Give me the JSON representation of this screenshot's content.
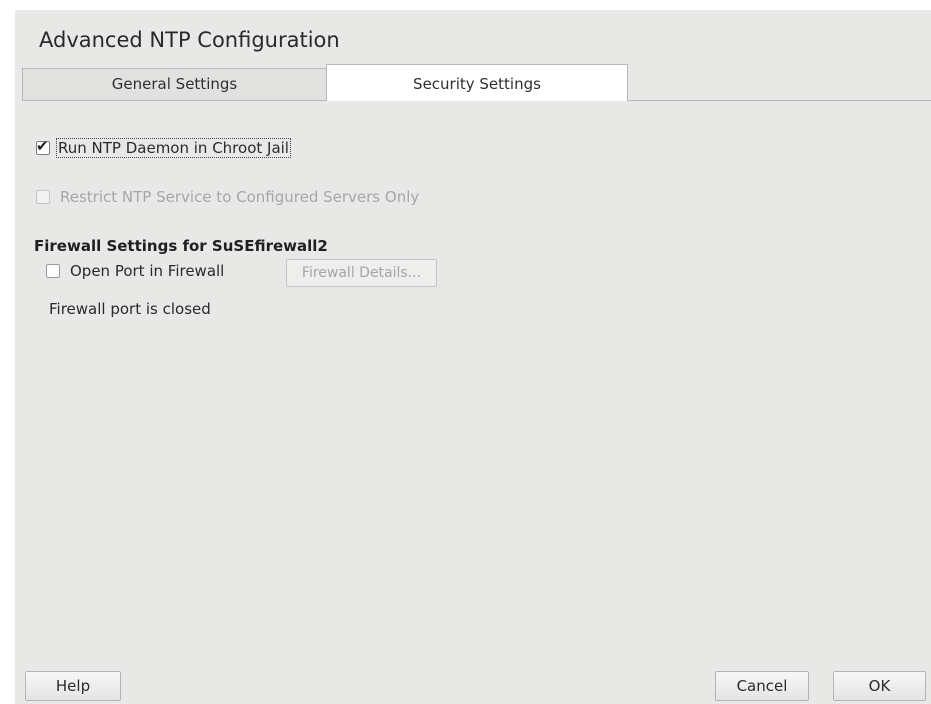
{
  "dialog": {
    "title": "Advanced NTP Configuration"
  },
  "tabs": [
    {
      "label": "General Settings",
      "mnemonic": "G",
      "active": false
    },
    {
      "label": "Security Settings",
      "mnemonic": "S",
      "active": true
    }
  ],
  "security": {
    "chroot": {
      "label": "Run NTP Daemon in Chroot Jail",
      "checked": true,
      "enabled": true
    },
    "restrict": {
      "label": "Restrict NTP Service to Configured Servers Only",
      "checked": false,
      "enabled": false
    }
  },
  "firewall": {
    "group_title": "Firewall Settings for SuSEfirewall2",
    "open_port_label": "Open Port in Firewall",
    "open_port_checked": false,
    "details_button": "Firewall Details...",
    "status": "Firewall port is closed"
  },
  "footer": {
    "help": "Help",
    "cancel": "Cancel",
    "ok": "OK"
  },
  "icons": {
    "checked_mark": "checkmark-icon"
  },
  "colors": {
    "background": "#e8e8e7",
    "active_tab": "#ffffff",
    "disabled_text": "#a6a6a6"
  }
}
